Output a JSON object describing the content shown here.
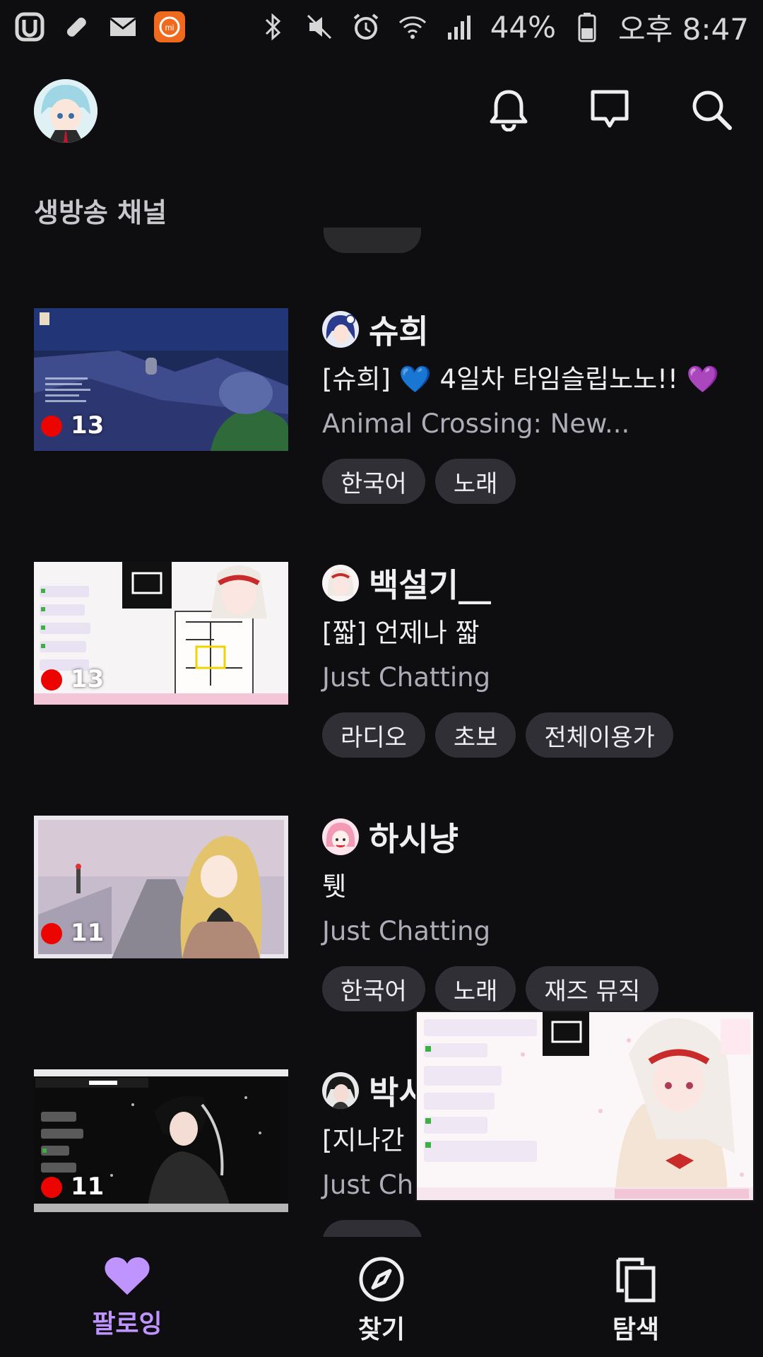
{
  "status_bar": {
    "battery": "44%",
    "time": "오후 8:47",
    "icons": [
      "u-plus-icon",
      "bandage-icon",
      "mail-icon",
      "mi-app-icon",
      "bluetooth-icon",
      "mute-icon",
      "alarm-icon",
      "wifi-icon",
      "signal-icon",
      "battery-icon"
    ]
  },
  "header": {
    "icons": [
      "notifications-bell-icon",
      "whispers-icon",
      "search-icon"
    ]
  },
  "section_title": "생방송 채널",
  "streams": [
    {
      "channel": "슈희",
      "title": "[슈희] 💙 4일차 타임슬립노노!! 💜",
      "category": "Animal Crossing: New...",
      "viewers": "13",
      "tags": [
        "한국어",
        "노래"
      ]
    },
    {
      "channel": "백설기__",
      "title": "[짧] 언제나 짧",
      "category": "Just Chatting",
      "viewers": "13",
      "tags": [
        "라디오",
        "초보",
        "전체이용가"
      ]
    },
    {
      "channel": "하시냥",
      "title": "퉷",
      "category": "Just Chatting",
      "viewers": "11",
      "tags": [
        "한국어",
        "노래",
        "재즈 뮤직"
      ]
    },
    {
      "channel": "박시",
      "title": "[지나간 ",
      "category": "Just Ch",
      "viewers": "11",
      "tags": []
    }
  ],
  "bottom_nav": {
    "following": "팔로잉",
    "browse": "찾기",
    "discover": "탐색"
  },
  "colors": {
    "background": "#0e0e10",
    "accent": "#bf94ff",
    "live": "#eb0400",
    "tag_bg": "#2f2f35",
    "secondary_text": "#adadb8"
  }
}
